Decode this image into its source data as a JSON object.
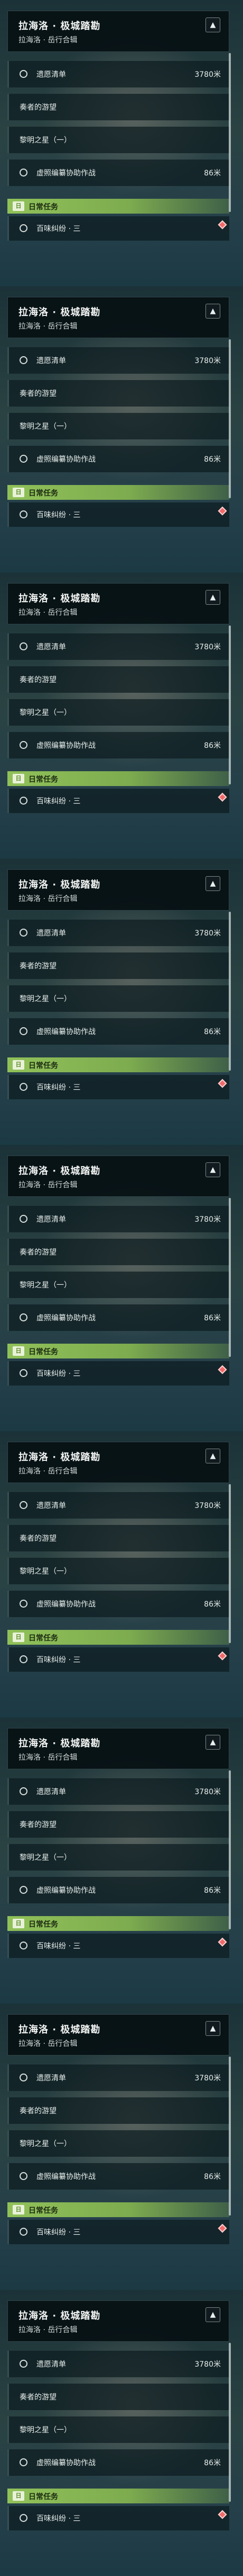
{
  "quest_title": "拉海洛 · 极城踏勘",
  "quest_subtitle": "拉海洛 · 岳行合辑",
  "collapse_glyph": "▲",
  "objectives": [
    {
      "label": "遗愿清单",
      "distance": "3780米"
    },
    {
      "label": "奏者的游望",
      "distance": ""
    },
    {
      "label": "黎明之星（一）",
      "distance": ""
    },
    {
      "label": "虚照编纂协助作战",
      "distance": "86米"
    }
  ],
  "daily_label": "日常任务",
  "daily_icon_text": "日",
  "daily_item": "百味纠纷 · 三",
  "colors": {
    "accent_green": "#8cc056",
    "marker_red": "#f06a6a"
  },
  "icons": [
    "collapse-icon",
    "daily-task-icon",
    "quest-marker-icon"
  ]
}
